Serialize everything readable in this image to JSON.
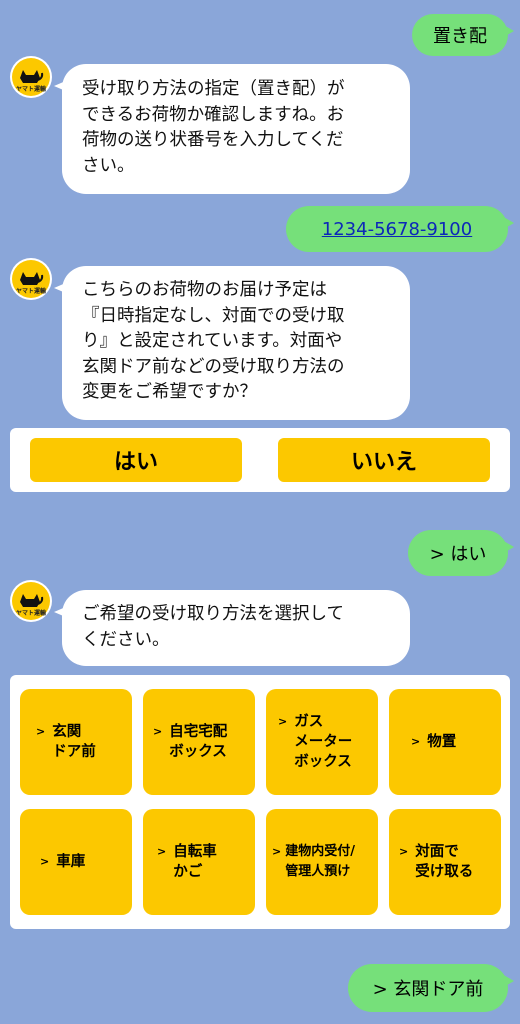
{
  "avatar": {
    "brand_text": "ヤマト運輸",
    "icon": "black-cat-icon"
  },
  "messages": {
    "user_1": "置き配",
    "bot_1": "受け取り方法の指定（置き配）が\nできるお荷物か確認しますね。お\n荷物の送り状番号を入力してくだ\nさい。",
    "user_2": "1234-5678-9100",
    "bot_2": "こちらのお荷物のお届け予定は\n『日時指定なし、対面での受け取\nり』と設定されています。対面や\n玄関ドア前などの受け取り方法の\n変更をご希望ですか？",
    "user_3": "> はい",
    "bot_3": "ご希望の受け取り方法を選択して\nください。",
    "user_4": "> 玄関ドア前"
  },
  "quick_reply": {
    "yes": "はい",
    "no": "いいえ"
  },
  "options": {
    "arrow": ">",
    "items": [
      "玄関\nドア前",
      "自宅宅配\nボックス",
      "ガス\nメーター\nボックス",
      "物置",
      "車庫",
      "自転車\nかご",
      "建物内受付/\n管理人預け",
      "対面で\n受け取る"
    ]
  },
  "colors": {
    "background": "#8aa6d9",
    "user_bubble": "#76e07a",
    "bot_bubble": "#ffffff",
    "button_yellow": "#fcc800"
  }
}
